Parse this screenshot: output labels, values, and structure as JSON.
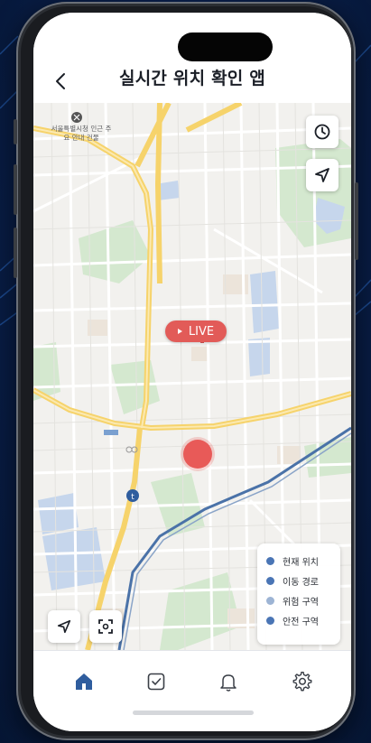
{
  "header": {
    "title": "실시간 위치 확인 앱"
  },
  "map": {
    "poi_label": "서울특별시청 인근 주요 안내 건물",
    "live_badge": "LIVE"
  },
  "legend": {
    "items": [
      {
        "label": "현재 위치",
        "color": "#4a75b5"
      },
      {
        "label": "이동 경로",
        "color": "#4a75b5"
      },
      {
        "label": "위험 구역",
        "color": "#9db4d4"
      },
      {
        "label": "안전 구역",
        "color": "#4a75b5"
      }
    ]
  },
  "colors": {
    "accent": "#2f5d9e",
    "live": "#e25b58",
    "road_major": "#f6d36b"
  },
  "icons": {
    "back": "chevron-left-icon",
    "history": "clock-icon",
    "navigate": "navigation-arrow-icon",
    "locate": "location-arrow-icon",
    "scan": "scan-frame-icon",
    "home": "home-icon",
    "check": "checkbox-icon",
    "bell": "bell-icon",
    "settings": "gear-icon"
  }
}
